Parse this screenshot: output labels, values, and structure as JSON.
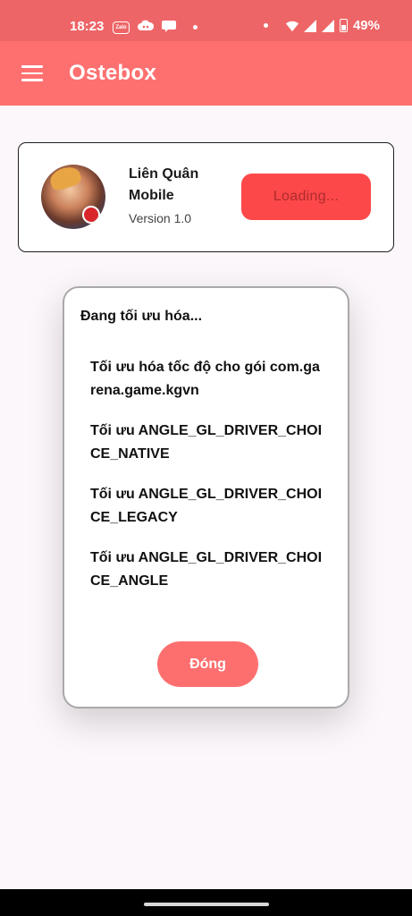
{
  "status_bar": {
    "time": "18:23",
    "zalo_label": "Zalo",
    "battery_percent": "49%",
    "icons": [
      "zalo-icon",
      "cloud-game-icon",
      "chat-bubble-icon",
      "dot-icon",
      "wifi-icon",
      "signal-icon",
      "battery-icon"
    ]
  },
  "app_bar": {
    "title": "Ostebox",
    "menu_icon": "hamburger-menu-icon"
  },
  "game_card": {
    "name": "Liên Quân Mobile",
    "version": "Version 1.0",
    "button_label": "Loading..."
  },
  "dialog": {
    "title": "Đang tối ưu hóa...",
    "items": [
      "Tối ưu hóa tốc độ cho gói com.garena.game.kgvn",
      "Tối ưu ANGLE_GL_DRIVER_CHOICE_NATIVE",
      "Tối ưu ANGLE_GL_DRIVER_CHOICE_LEGACY",
      "Tối ưu ANGLE_GL_DRIVER_CHOICE_ANGLE"
    ],
    "close_label": "Đóng"
  },
  "colors": {
    "status_bar": "#ee6567",
    "app_bar": "#fe7070",
    "loading_button": "#fd4849",
    "close_button": "#fd6f6f",
    "background": "#fcf7fb"
  }
}
